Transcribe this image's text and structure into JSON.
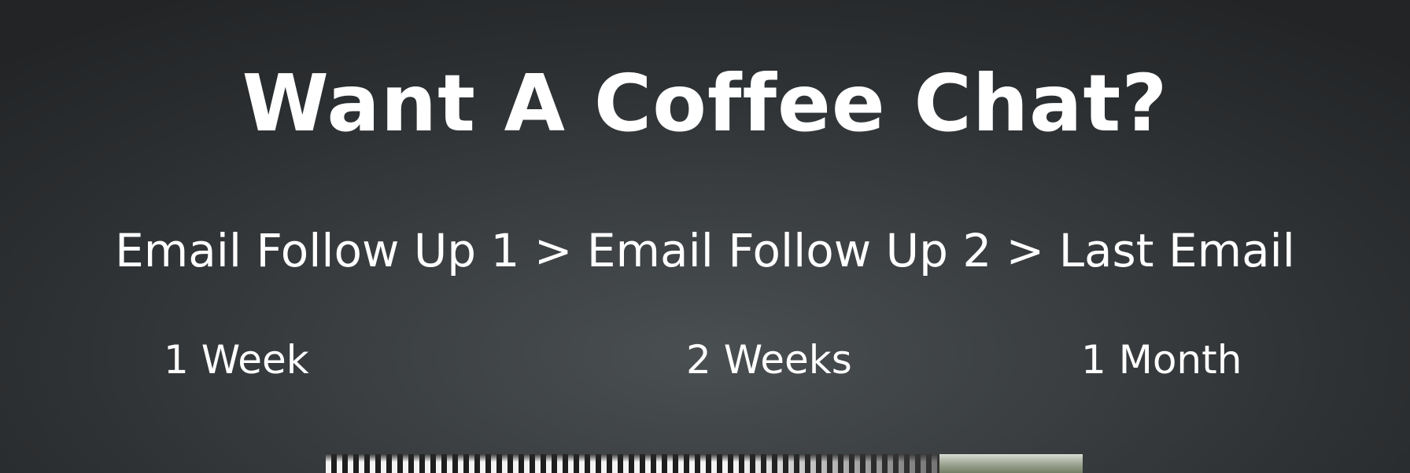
{
  "slide": {
    "title": "Want A Coffee Chat?",
    "sequence": "Email Follow Up 1 > Email Follow Up 2 > Last Email",
    "timings": [
      "1 Week",
      "2 Weeks",
      "1 Month"
    ]
  },
  "colors": {
    "background": "#3b3f41",
    "text": "#ffffff"
  }
}
